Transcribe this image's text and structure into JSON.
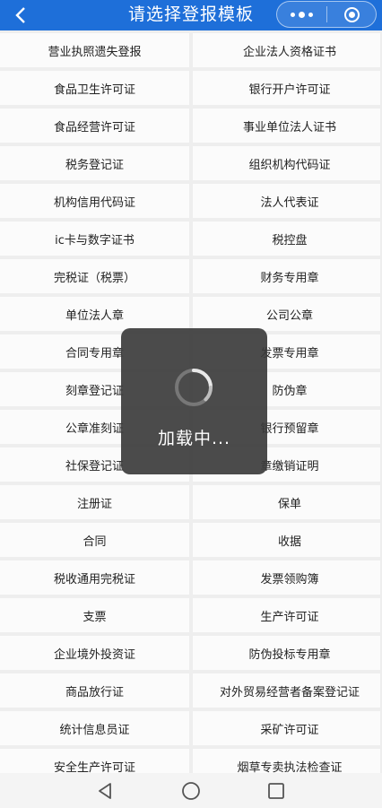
{
  "header": {
    "title": "请选择登报模板",
    "back_icon": "chevron-left-icon",
    "more_icon": "more-dots-icon",
    "close_icon": "close-circle-icon"
  },
  "templates": [
    [
      "营业执照遗失登报",
      "企业法人资格证书"
    ],
    [
      "食品卫生许可证",
      "银行开户许可证"
    ],
    [
      "食品经营许可证",
      "事业单位法人证书"
    ],
    [
      "税务登记证",
      "组织机构代码证"
    ],
    [
      "机构信用代码证",
      "法人代表证"
    ],
    [
      "ic卡与数字证书",
      "税控盘"
    ],
    [
      "完税证（税票）",
      "财务专用章"
    ],
    [
      "单位法人章",
      "公司公章"
    ],
    [
      "合同专用章",
      "发票专用章"
    ],
    [
      "刻章登记证",
      "防伪章"
    ],
    [
      "公章准刻证",
      "银行预留章"
    ],
    [
      "社保登记证",
      "章缴销证明"
    ],
    [
      "注册证",
      "保单"
    ],
    [
      "合同",
      "收据"
    ],
    [
      "税收通用完税证",
      "发票领购簿"
    ],
    [
      "支票",
      "生产许可证"
    ],
    [
      "企业境外投资证",
      "防伪投标专用章"
    ],
    [
      "商品放行证",
      "对外贸易经营者备案登记证"
    ],
    [
      "统计信息员证",
      "采矿许可证"
    ],
    [
      "安全生产许可证",
      "烟草专卖执法检查证"
    ]
  ],
  "loading": {
    "text": "加载中..."
  },
  "navbar": {
    "back_icon": "triangle-back-icon",
    "home_icon": "circle-home-icon",
    "recents_icon": "square-recents-icon"
  },
  "colors": {
    "header_bg": "#1e6fd9",
    "page_bg": "#eeeeee",
    "cell_bg": "#fbfbfb",
    "toast_bg": "#3c3c3c"
  }
}
